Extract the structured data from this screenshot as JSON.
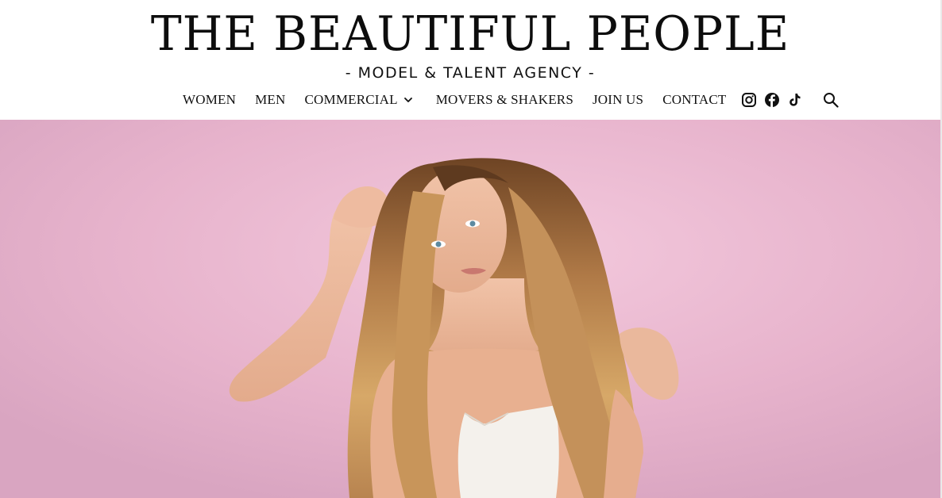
{
  "brand": {
    "title": "THE BEAUTIFUL PEOPLE",
    "tagline": "- MODEL & TALENT  AGENCY -"
  },
  "nav": {
    "items": [
      {
        "label": "WOMEN"
      },
      {
        "label": "MEN"
      },
      {
        "label": "COMMERCIAL",
        "has_dropdown": true
      },
      {
        "label": "MOVERS & SHAKERS"
      },
      {
        "label": "JOIN US"
      },
      {
        "label": "CONTACT"
      }
    ],
    "social": [
      "instagram-icon",
      "facebook-icon",
      "tiktok-icon"
    ],
    "search_icon": "search-icon"
  },
  "hero": {
    "image": "model-portrait-photo",
    "background_color": "#e9b4cd"
  },
  "colors": {
    "text": "#111111",
    "header_bg": "#ffffff"
  }
}
